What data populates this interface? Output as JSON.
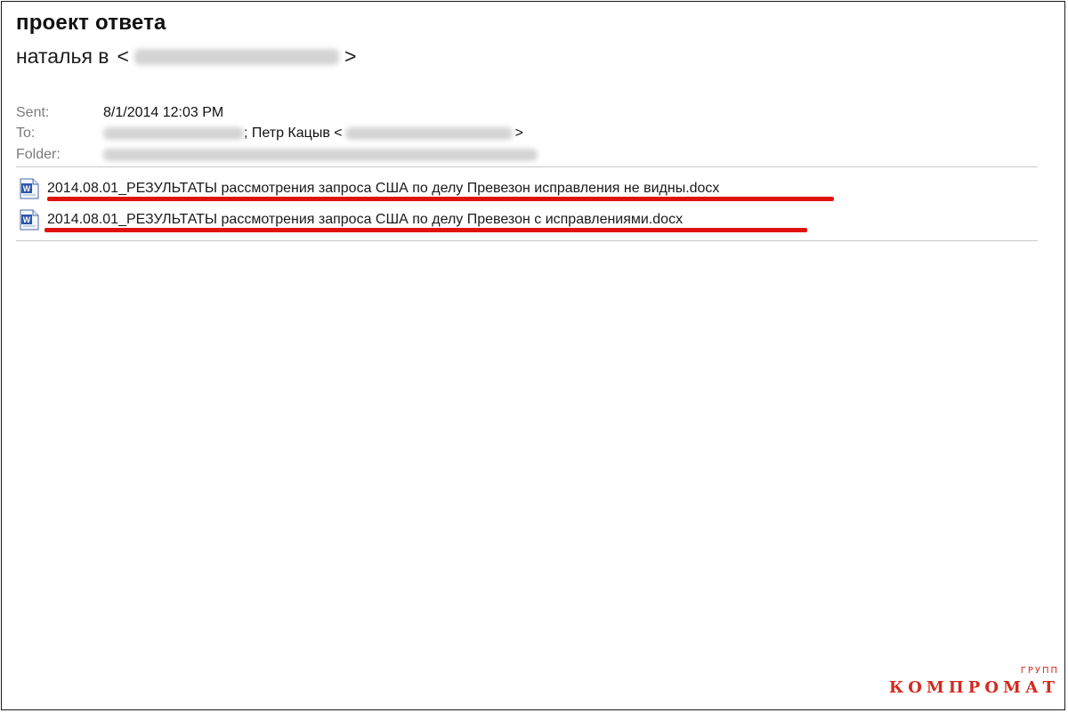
{
  "email": {
    "subject": "проект ответа",
    "from": {
      "name": "наталья в",
      "open_bracket": "<",
      "close_bracket": ">"
    },
    "meta": {
      "sent_label": "Sent:",
      "sent_value": "8/1/2014 12:03 PM",
      "to_label": "To:",
      "to_recipient_name": "; Петр Кацыв <",
      "to_close": ">",
      "folder_label": "Folder:"
    },
    "attachments": [
      {
        "name": "2014.08.01_РЕЗУЛЬТАТЫ рассмотрения запроса США по делу Превезон исправления не видны.docx",
        "icon": "word-doc-icon"
      },
      {
        "name": "2014.08.01_РЕЗУЛЬТАТЫ рассмотрения запроса США по делу Превезон с исправлениями.docx",
        "icon": "word-doc-icon"
      }
    ],
    "highlight_color": "#e0130b"
  },
  "watermark": {
    "sup": "ГРУПП",
    "main": "КОМПРОМАТ",
    "color": "#d42a1f"
  }
}
